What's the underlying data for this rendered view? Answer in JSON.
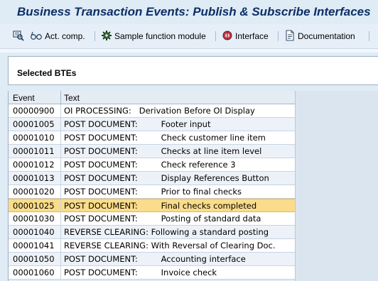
{
  "window": {
    "title": "Business Transaction Events: Publish & Subscribe Interfaces"
  },
  "toolbar": {
    "items": [
      {
        "icon": "display-icon",
        "label": ""
      },
      {
        "icon": "glasses-icon",
        "label": "Act. comp."
      },
      {
        "icon": "function-module-icon",
        "label": "Sample function module"
      },
      {
        "icon": "interface-icon",
        "label": "Interface"
      },
      {
        "icon": "documentation-icon",
        "label": "Documentation"
      }
    ]
  },
  "panel": {
    "title": "Selected BTEs"
  },
  "table": {
    "columns": [
      "Event",
      "Text"
    ],
    "selected_index": 7,
    "rows": [
      {
        "event": "00000900",
        "text": "OI PROCESSING:   Derivation Before OI Display"
      },
      {
        "event": "00001005",
        "text": "POST DOCUMENT:         Footer input"
      },
      {
        "event": "00001010",
        "text": "POST DOCUMENT:         Check customer line item"
      },
      {
        "event": "00001011",
        "text": "POST DOCUMENT:         Checks at line item level"
      },
      {
        "event": "00001012",
        "text": "POST DOCUMENT:         Check reference 3"
      },
      {
        "event": "00001013",
        "text": "POST DOCUMENT:         Display References Button"
      },
      {
        "event": "00001020",
        "text": "POST DOCUMENT:         Prior to final checks"
      },
      {
        "event": "00001025",
        "text": "POST DOCUMENT:         Final checks completed"
      },
      {
        "event": "00001030",
        "text": "POST DOCUMENT:         Posting of standard data"
      },
      {
        "event": "00001040",
        "text": "REVERSE CLEARING: Following a standard posting"
      },
      {
        "event": "00001041",
        "text": "REVERSE CLEARING: With Reversal of Clearing Doc."
      },
      {
        "event": "00001050",
        "text": "POST DOCUMENT:         Accounting interface"
      },
      {
        "event": "00001060",
        "text": "POST DOCUMENT:         Invoice check"
      }
    ]
  }
}
